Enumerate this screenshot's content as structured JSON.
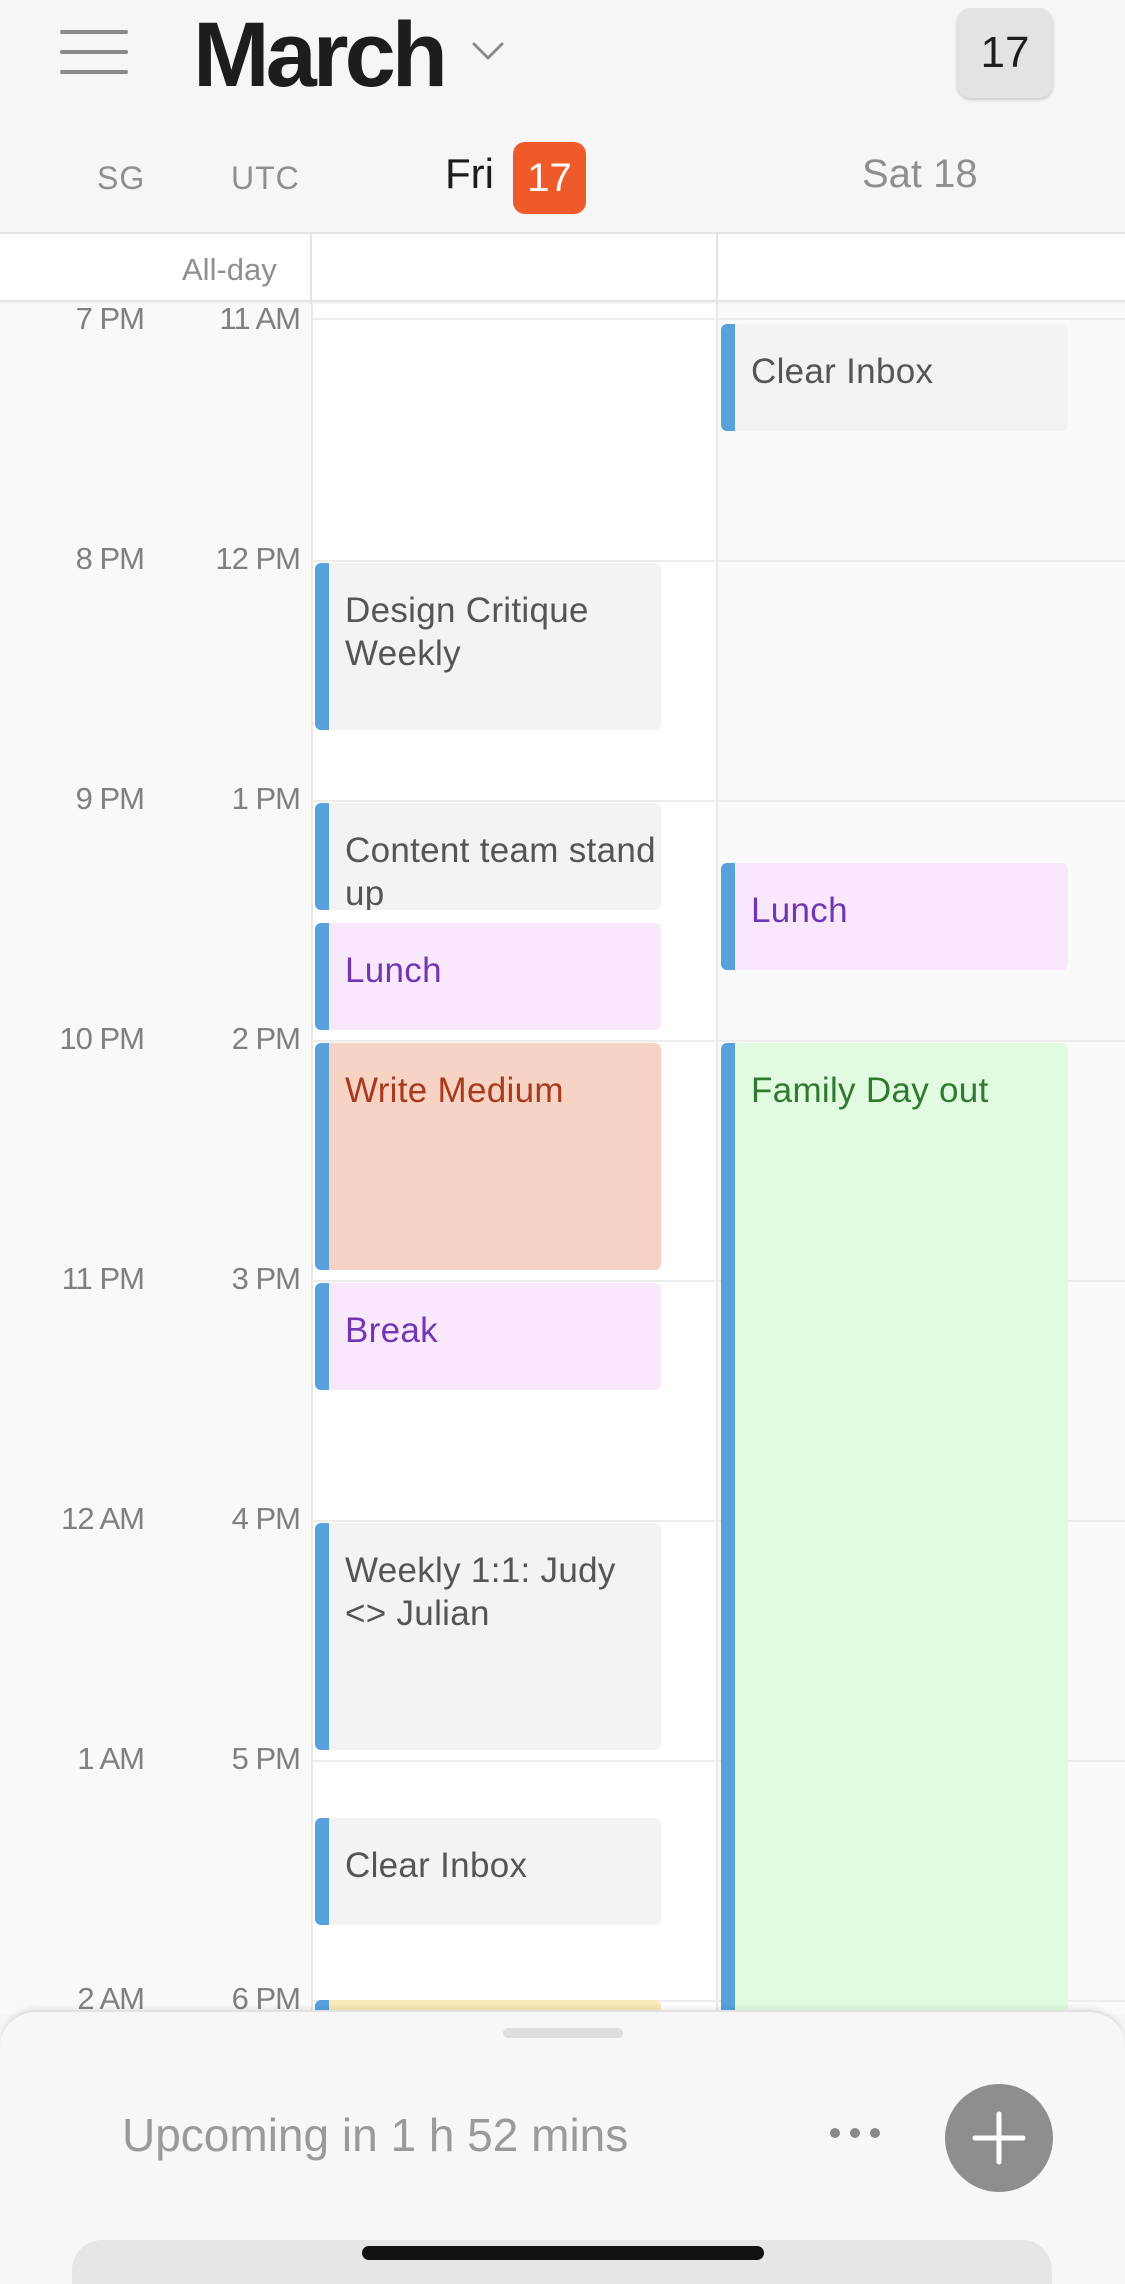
{
  "header": {
    "month": "March",
    "today_button": "17",
    "timezones": [
      "SG",
      "UTC"
    ],
    "days": [
      {
        "label": "Fri",
        "date": "17",
        "is_today": true
      },
      {
        "label": "Sat 18",
        "is_today": false
      }
    ],
    "accent_color": "#ef5a2a"
  },
  "allday": {
    "label": "All-day"
  },
  "times": [
    {
      "sg": "7 PM",
      "utc": "11 AM"
    },
    {
      "sg": "8 PM",
      "utc": "12 PM"
    },
    {
      "sg": "9 PM",
      "utc": "1 PM"
    },
    {
      "sg": "10 PM",
      "utc": "2 PM"
    },
    {
      "sg": "11 PM",
      "utc": "3 PM"
    },
    {
      "sg": "12 AM",
      "utc": "4 PM"
    },
    {
      "sg": "1 AM",
      "utc": "5 PM"
    },
    {
      "sg": "2 AM",
      "utc": "6 PM"
    }
  ],
  "events": {
    "fri": [
      {
        "title": "Design Critique Weekly",
        "color": "gray"
      },
      {
        "title": "Content team stand up",
        "color": "gray"
      },
      {
        "title": "Lunch",
        "color": "purple"
      },
      {
        "title": "Write Medium",
        "color": "orange"
      },
      {
        "title": "Break",
        "color": "purple"
      },
      {
        "title": "Weekly 1:1: Judy <> Julian",
        "color": "gray"
      },
      {
        "title": "Clear Inbox",
        "color": "gray"
      },
      {
        "title": "",
        "color": "yellow"
      }
    ],
    "sat": [
      {
        "title": "Clear Inbox",
        "color": "gray"
      },
      {
        "title": "Lunch",
        "color": "purple"
      },
      {
        "title": "Family Day out",
        "color": "green"
      }
    ]
  },
  "bottom_sheet": {
    "upcoming_text": "Upcoming in 1 h 52 mins",
    "more_icon": "ellipsis-icon",
    "add_icon": "plus-icon"
  }
}
